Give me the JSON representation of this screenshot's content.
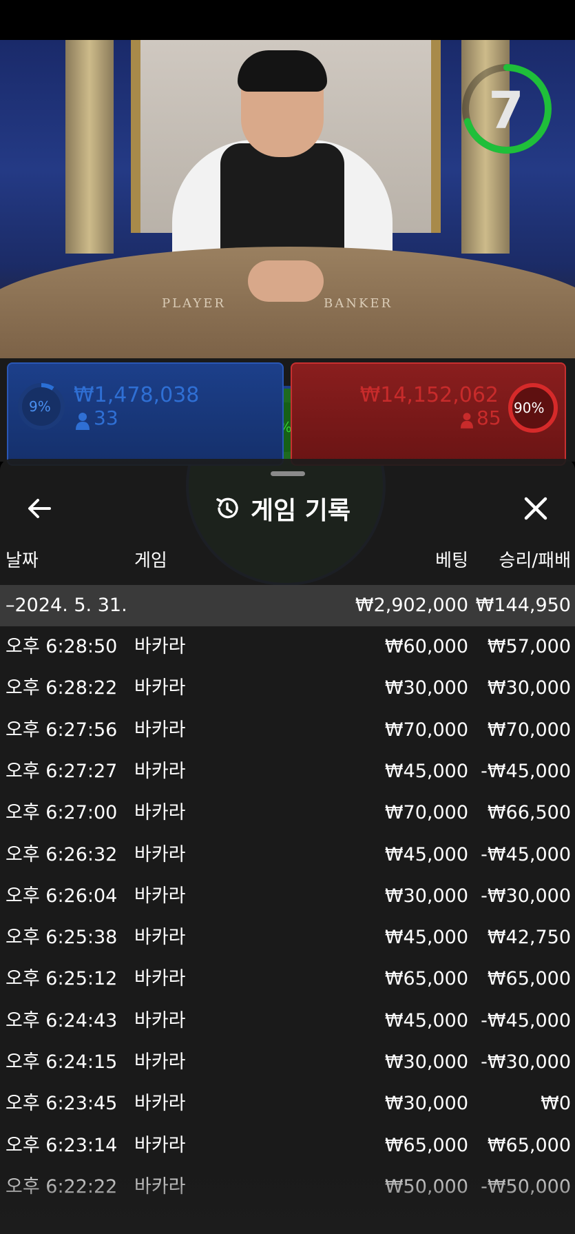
{
  "timer": {
    "value": "7",
    "progress": 0.7
  },
  "table_labels": {
    "player": "PLAYER",
    "banker": "BANKER"
  },
  "bets": {
    "player": {
      "percent": "9%",
      "amount": "₩1,478,038",
      "count": "33"
    },
    "banker": {
      "percent": "90%",
      "amount": "₩14,152,062",
      "count": "85"
    },
    "tie": {
      "percent": "1%"
    }
  },
  "panel": {
    "title": "게임 기록",
    "columns": {
      "date": "날짜",
      "game": "게임",
      "bet": "베팅",
      "result": "승리/패배"
    },
    "group_row": {
      "date": "–2024. 5. 31.",
      "bet": "₩2,902,000",
      "result": "₩144,950"
    },
    "rows": [
      {
        "date": "오후 6:28:50",
        "game": "바카라",
        "bet": "₩60,000",
        "result": "₩57,000"
      },
      {
        "date": "오후 6:28:22",
        "game": "바카라",
        "bet": "₩30,000",
        "result": "₩30,000"
      },
      {
        "date": "오후 6:27:56",
        "game": "바카라",
        "bet": "₩70,000",
        "result": "₩70,000"
      },
      {
        "date": "오후 6:27:27",
        "game": "바카라",
        "bet": "₩45,000",
        "result": "-₩45,000"
      },
      {
        "date": "오후 6:27:00",
        "game": "바카라",
        "bet": "₩70,000",
        "result": "₩66,500"
      },
      {
        "date": "오후 6:26:32",
        "game": "바카라",
        "bet": "₩45,000",
        "result": "-₩45,000"
      },
      {
        "date": "오후 6:26:04",
        "game": "바카라",
        "bet": "₩30,000",
        "result": "-₩30,000"
      },
      {
        "date": "오후 6:25:38",
        "game": "바카라",
        "bet": "₩45,000",
        "result": "₩42,750"
      },
      {
        "date": "오후 6:25:12",
        "game": "바카라",
        "bet": "₩65,000",
        "result": "₩65,000"
      },
      {
        "date": "오후 6:24:43",
        "game": "바카라",
        "bet": "₩45,000",
        "result": "-₩45,000"
      },
      {
        "date": "오후 6:24:15",
        "game": "바카라",
        "bet": "₩30,000",
        "result": "-₩30,000"
      },
      {
        "date": "오후 6:23:45",
        "game": "바카라",
        "bet": "₩30,000",
        "result": "₩0"
      },
      {
        "date": "오후 6:23:14",
        "game": "바카라",
        "bet": "₩65,000",
        "result": "₩65,000"
      },
      {
        "date": "오후 6:22:22",
        "game": "바카라",
        "bet": "₩50,000",
        "result": "-₩50,000"
      }
    ]
  },
  "icons": {
    "back": "arrow-left-icon",
    "history": "history-clock-icon",
    "close": "close-icon",
    "person": "person-icon"
  },
  "colors": {
    "player_blue": "#2a6fd6",
    "banker_red": "#d62a2a",
    "tie_green": "#2ea82e",
    "timer_green": "#1fbf3a"
  }
}
